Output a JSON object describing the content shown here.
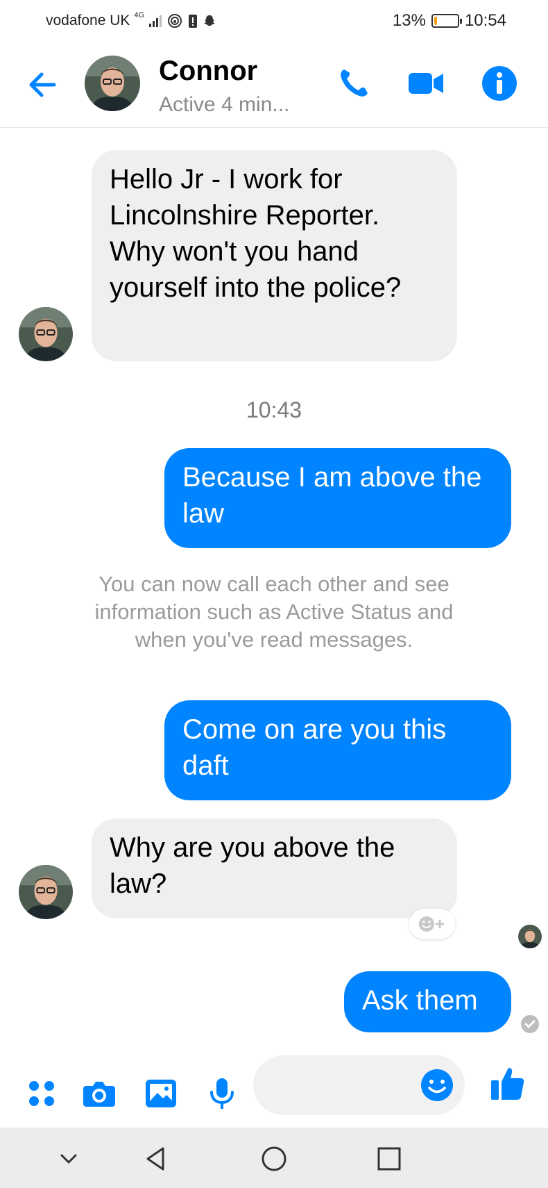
{
  "status_bar": {
    "carrier": "vodafone UK",
    "network": "4G",
    "battery_percent": "13%",
    "battery_level": 0.13,
    "time": "10:54",
    "battery_color": "#f39c12"
  },
  "header": {
    "contact_name": "Connor",
    "contact_status": "Active 4 min...",
    "icons": [
      "back-arrow-icon",
      "phone-icon",
      "video-camera-icon",
      "info-icon"
    ],
    "accent_color": "#0084ff"
  },
  "messages": [
    {
      "sender": "Connor",
      "direction": "incoming",
      "text": "Hello Jr - I work for Lincolnshire Reporter. Why won't you hand yourself into the police?"
    },
    {
      "type": "timestamp",
      "text": "10:43"
    },
    {
      "sender": "me",
      "direction": "outgoing",
      "text": "Because I am above the law"
    },
    {
      "type": "system",
      "text": "You can now call each other and see information such as Active Status and when you've read messages."
    },
    {
      "sender": "me",
      "direction": "outgoing",
      "text": "Come on are you this daft"
    },
    {
      "sender": "Connor",
      "direction": "incoming",
      "text": "Why are you above the law?"
    },
    {
      "sender": "me",
      "direction": "outgoing",
      "text": "Ask them"
    }
  ],
  "composer": {
    "placeholder": "",
    "icons": [
      "apps-grid-icon",
      "camera-icon",
      "gallery-icon",
      "microphone-icon",
      "emoji-icon",
      "thumbs-up-icon"
    ]
  },
  "navigation_bar": {
    "icons": [
      "chevron-down-icon",
      "back-triangle-icon",
      "home-circle-icon",
      "recents-square-icon"
    ]
  }
}
